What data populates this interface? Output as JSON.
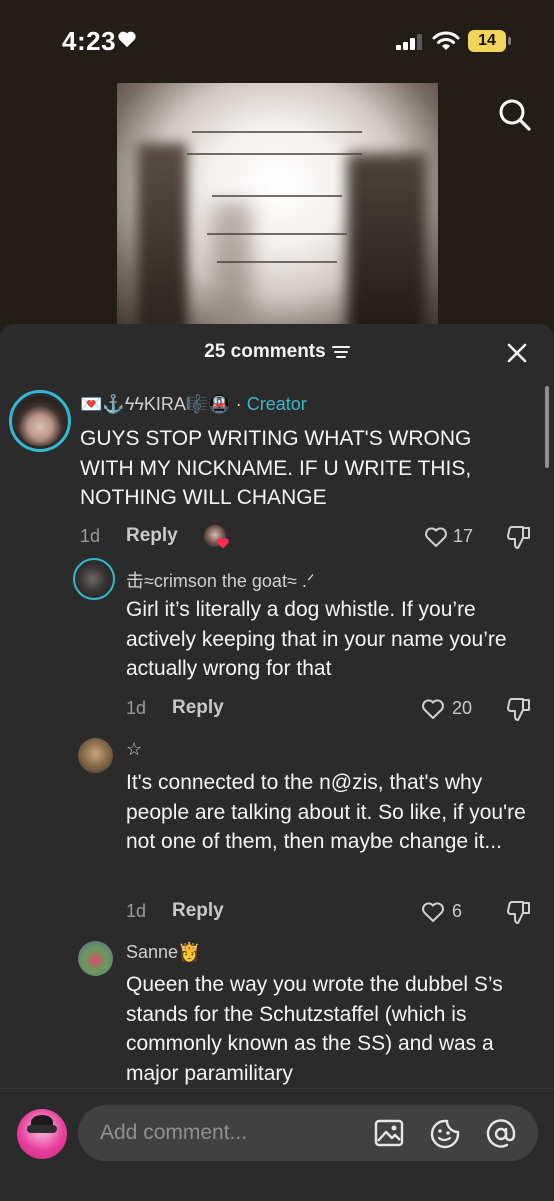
{
  "status_bar": {
    "time": "4:23",
    "battery": "14"
  },
  "comments_header": {
    "count_label": "25 comments"
  },
  "comments": [
    {
      "username": "💌⚓ϟϟKIRA🎼🚇",
      "separator": "·",
      "badge": "Creator",
      "text": "GUYS STOP WRITING WHAT'S WRONG WITH MY NICKNAME. IF U WRITE THIS, NOTHING WILL CHANGE",
      "time": "1d",
      "reply_label": "Reply",
      "likes": "17"
    },
    {
      "username": "击≈crimson the goat≈ .ᐟ",
      "text": "Girl it’s literally a dog whistle. If you’re actively keeping that in your name you’re actually wrong for that",
      "time": "1d",
      "reply_label": "Reply",
      "likes": "20"
    },
    {
      "username": "☆",
      "text": "It's connected to the n@zis, that's why people are talking about it. So like, if you're not one of them, then maybe change it...",
      "time": "1d",
      "reply_label": "Reply",
      "likes": "6"
    },
    {
      "username": "Sanne👸",
      "text": "Queen the way you wrote the dubbel S’s stands for the Schutzstaffel (which is commonly known as the SS) and was a major paramilitary"
    }
  ],
  "composer": {
    "placeholder": "Add comment..."
  },
  "colors": {
    "creator_badge": "#3fb6c8",
    "sheet_bg": "#2c2b2b",
    "battery": "#f2d45a"
  }
}
